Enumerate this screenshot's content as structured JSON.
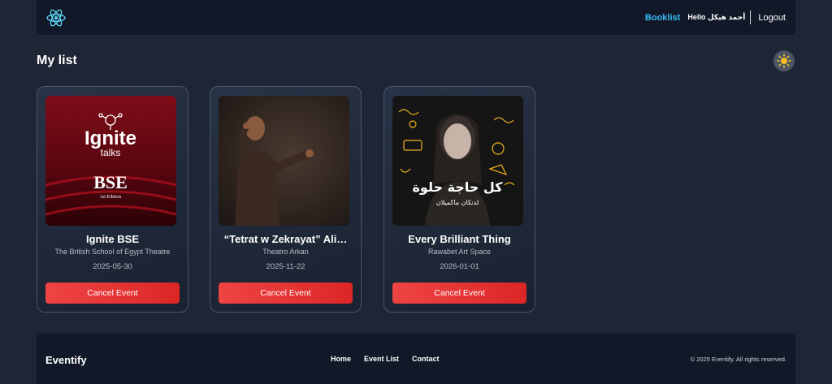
{
  "nav": {
    "logo_icon": "react-atom-icon",
    "booklist_label": "Booklist",
    "greeting": "Hello أحمد هيكل",
    "logout_label": "Logout"
  },
  "page": {
    "title": "My list",
    "theme_icon": "sun-icon"
  },
  "events": [
    {
      "title": "Ignite BSE",
      "venue": "The British School of Egypt Theatre",
      "date": "2025-05-30",
      "cancel_label": "Cancel Event",
      "poster_line1": "Ignite",
      "poster_line2": "talks",
      "poster_line3": "BSE",
      "poster_line4": "1st Edition"
    },
    {
      "title": "“Tetrat w Zekrayat” Ali…",
      "venue": "Theatro Arkan",
      "date": "2025-11-22",
      "cancel_label": "Cancel Event"
    },
    {
      "title": "Every Brilliant Thing",
      "venue": "Rawabet Art Space",
      "date": "2026-01-01",
      "cancel_label": "Cancel Event",
      "poster_line1": "كل حاجة حلوة",
      "poster_line2": "لدنكان ماكميلان"
    }
  ],
  "footer": {
    "brand": "Eventify",
    "links": [
      "Home",
      "Event List",
      "Contact"
    ],
    "copyright": "© 2025 Eventify. All rights reserved."
  },
  "colors": {
    "accent": "#38bdf8",
    "danger": "#ef4444",
    "background": "#1e2535",
    "surface": "#111827"
  }
}
